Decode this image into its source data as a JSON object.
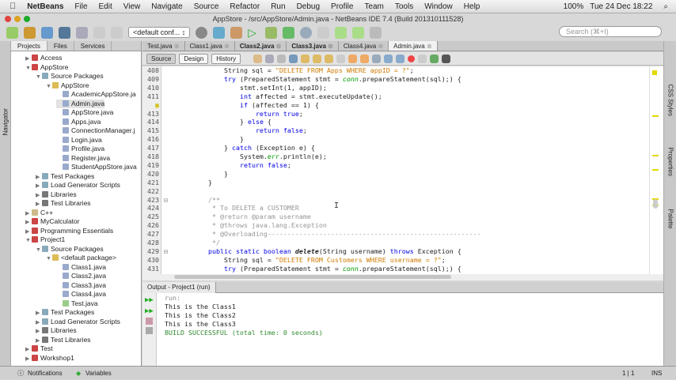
{
  "menubar": {
    "app": "NetBeans",
    "items": [
      "File",
      "Edit",
      "View",
      "Navigate",
      "Source",
      "Refactor",
      "Run",
      "Debug",
      "Profile",
      "Team",
      "Tools",
      "Window",
      "Help"
    ],
    "battery": "100%",
    "clock": "Tue 24 Dec  18:22"
  },
  "window": {
    "title": "AppStore - /src/AppStore/Admin.java - NetBeans IDE 7.4 (Build 201310111528)"
  },
  "toolbar": {
    "config": "<default conf... ↕",
    "search_placeholder": "Search (⌘+I)"
  },
  "navigator_label": "Navigator",
  "projects_panel": {
    "tabs": [
      "Projects",
      "Files",
      "Services"
    ],
    "tree": [
      {
        "label": "Access",
        "level": 0,
        "state": "collapsed",
        "icon": "project"
      },
      {
        "label": "AppStore",
        "level": 0,
        "state": "expanded",
        "icon": "project"
      },
      {
        "label": "Source Packages",
        "level": 1,
        "state": "expanded",
        "icon": "folder"
      },
      {
        "label": "AppStore",
        "level": 2,
        "state": "expanded",
        "icon": "package"
      },
      {
        "label": "AcademicAppStore.ja",
        "level": 3,
        "icon": "java-file"
      },
      {
        "label": "Admin.java",
        "level": 3,
        "icon": "java-file",
        "selected": true
      },
      {
        "label": "AppStore.java",
        "level": 3,
        "icon": "java-file"
      },
      {
        "label": "Apps.java",
        "level": 3,
        "icon": "java-file"
      },
      {
        "label": "ConnectionManager.j",
        "level": 3,
        "icon": "java-file"
      },
      {
        "label": "Login.java",
        "level": 3,
        "icon": "java-file"
      },
      {
        "label": "Profile.java",
        "level": 3,
        "icon": "java-file"
      },
      {
        "label": "Register.java",
        "level": 3,
        "icon": "java-file"
      },
      {
        "label": "StudentAppStore.java",
        "level": 3,
        "icon": "java-file"
      },
      {
        "label": "Test Packages",
        "level": 1,
        "state": "collapsed",
        "icon": "folder"
      },
      {
        "label": "Load Generator Scripts",
        "level": 1,
        "state": "collapsed",
        "icon": "folder"
      },
      {
        "label": "Libraries",
        "level": 1,
        "state": "collapsed",
        "icon": "library"
      },
      {
        "label": "Test Libraries",
        "level": 1,
        "state": "collapsed",
        "icon": "library"
      },
      {
        "label": "C++",
        "level": 0,
        "state": "collapsed",
        "icon": "cpp-project"
      },
      {
        "label": "MyCalculator",
        "level": 0,
        "state": "collapsed",
        "icon": "project"
      },
      {
        "label": "Programming Essentials",
        "level": 0,
        "state": "collapsed",
        "icon": "project"
      },
      {
        "label": "Project1",
        "level": 0,
        "state": "expanded",
        "icon": "project"
      },
      {
        "label": "Source Packages",
        "level": 1,
        "state": "expanded",
        "icon": "folder"
      },
      {
        "label": "<default package>",
        "level": 2,
        "state": "expanded",
        "icon": "package"
      },
      {
        "label": "Class1.java",
        "level": 3,
        "icon": "java-file"
      },
      {
        "label": "Class2.java",
        "level": 3,
        "icon": "java-file"
      },
      {
        "label": "Class3.java",
        "level": 3,
        "icon": "java-file"
      },
      {
        "label": "Class4.java",
        "level": 3,
        "icon": "java-file"
      },
      {
        "label": "Test.java",
        "level": 3,
        "icon": "java-main-file"
      },
      {
        "label": "Test Packages",
        "level": 1,
        "state": "collapsed",
        "icon": "folder"
      },
      {
        "label": "Load Generator Scripts",
        "level": 1,
        "state": "collapsed",
        "icon": "folder"
      },
      {
        "label": "Libraries",
        "level": 1,
        "state": "collapsed",
        "icon": "library"
      },
      {
        "label": "Test Libraries",
        "level": 1,
        "state": "collapsed",
        "icon": "library"
      },
      {
        "label": "Test",
        "level": 0,
        "state": "collapsed",
        "icon": "project"
      },
      {
        "label": "Workshop1",
        "level": 0,
        "state": "collapsed",
        "icon": "project"
      }
    ]
  },
  "editor": {
    "tabs": [
      {
        "label": "Test.java"
      },
      {
        "label": "Class1.java"
      },
      {
        "label": "Class2.java",
        "bold": true
      },
      {
        "label": "Class3.java",
        "bold": true
      },
      {
        "label": "Class4.java"
      },
      {
        "label": "Admin.java",
        "active": true
      }
    ],
    "views": [
      "Source",
      "Design",
      "History"
    ],
    "active_view": "Source",
    "lines": [
      {
        "n": "408",
        "indent": 8,
        "t": [
          [
            "String sql = ",
            ""
          ],
          [
            "\"DELETE FROM Apps WHERE appID = ?\"",
            "str"
          ],
          [
            ";",
            ""
          ]
        ]
      },
      {
        "n": "409",
        "indent": 8,
        "t": [
          [
            "try",
            "kw"
          ],
          [
            " (PreparedStatement stmt = ",
            ""
          ],
          [
            "conn",
            "fld"
          ],
          [
            ".prepareStatement(sql);) {",
            ""
          ]
        ]
      },
      {
        "n": "410",
        "indent": 12,
        "t": [
          [
            "stmt.setInt(1, appID);",
            ""
          ]
        ]
      },
      {
        "n": "411",
        "indent": 12,
        "t": [
          [
            "int",
            "kw"
          ],
          [
            " affected = stmt.executeUpdate();",
            ""
          ]
        ]
      },
      {
        "n": "",
        "indent": 12,
        "hint": true,
        "t": [
          [
            "if",
            "kw"
          ],
          [
            " (affected == 1) {",
            ""
          ]
        ]
      },
      {
        "n": "413",
        "indent": 16,
        "t": [
          [
            "return true",
            "kw"
          ],
          [
            ";",
            ""
          ]
        ]
      },
      {
        "n": "414",
        "indent": 12,
        "t": [
          [
            "} ",
            ""
          ],
          [
            "else",
            "kw"
          ],
          [
            " {",
            ""
          ]
        ]
      },
      {
        "n": "415",
        "indent": 16,
        "t": [
          [
            "return false",
            "kw"
          ],
          [
            ";",
            ""
          ]
        ]
      },
      {
        "n": "416",
        "indent": 12,
        "t": [
          [
            "}",
            ""
          ]
        ]
      },
      {
        "n": "417",
        "indent": 8,
        "t": [
          [
            "} ",
            ""
          ],
          [
            "catch",
            "kw"
          ],
          [
            " (Exception e) {",
            ""
          ]
        ]
      },
      {
        "n": "418",
        "indent": 12,
        "t": [
          [
            "System.",
            ""
          ],
          [
            "err",
            "fld"
          ],
          [
            ".println(e);",
            ""
          ]
        ]
      },
      {
        "n": "419",
        "indent": 12,
        "t": [
          [
            "return false",
            "kw"
          ],
          [
            ";",
            ""
          ]
        ]
      },
      {
        "n": "420",
        "indent": 8,
        "t": [
          [
            "}",
            ""
          ]
        ]
      },
      {
        "n": "421",
        "indent": 4,
        "t": [
          [
            "}",
            ""
          ]
        ]
      },
      {
        "n": "422",
        "indent": 0,
        "t": []
      },
      {
        "n": "423",
        "indent": 4,
        "fold": true,
        "t": [
          [
            "/**",
            "cm"
          ]
        ]
      },
      {
        "n": "424",
        "indent": 4,
        "t": [
          [
            " * To DELETE a CUSTOMER",
            "cm"
          ]
        ]
      },
      {
        "n": "425",
        "indent": 4,
        "t": [
          [
            " * @return @param username",
            "cm"
          ]
        ]
      },
      {
        "n": "426",
        "indent": 4,
        "t": [
          [
            " * @throws java.lang.Exception",
            "cm"
          ]
        ]
      },
      {
        "n": "427",
        "indent": 4,
        "t": [
          [
            " * @Overloading------------------------------------------------------",
            "cm"
          ]
        ]
      },
      {
        "n": "428",
        "indent": 4,
        "t": [
          [
            " */",
            "cm"
          ]
        ]
      },
      {
        "n": "429",
        "indent": 4,
        "fold": true,
        "t": [
          [
            "public static boolean ",
            "kw"
          ],
          [
            "delete",
            "it"
          ],
          [
            "(String username) ",
            ""
          ],
          [
            "throws",
            "kw"
          ],
          [
            " Exception {",
            ""
          ]
        ]
      },
      {
        "n": "430",
        "indent": 8,
        "t": [
          [
            "String sql = ",
            ""
          ],
          [
            "\"DELETE FROM Customers WHERE username = ?\"",
            "str"
          ],
          [
            ";",
            ""
          ]
        ]
      },
      {
        "n": "431",
        "indent": 8,
        "t": [
          [
            "try",
            "kw"
          ],
          [
            " (PreparedStatement stmt = ",
            ""
          ],
          [
            "conn",
            "fld"
          ],
          [
            ".prepareStatement(sql);) {",
            ""
          ]
        ]
      }
    ]
  },
  "right_panels": [
    "CSS Styles",
    "Properties",
    "Palette"
  ],
  "output": {
    "title": "Output - Project1 (run)",
    "lines": [
      {
        "text": "run:",
        "kind": "info"
      },
      {
        "text": "This is the Class1",
        "kind": "out"
      },
      {
        "text": "This is the Class2",
        "kind": "out"
      },
      {
        "text": "This is the Class3",
        "kind": "out"
      },
      {
        "text": "BUILD SUCCESSFUL (total time: 0 seconds)",
        "kind": "success"
      }
    ]
  },
  "statusbar": {
    "notifications": "Notifications",
    "variables": "Variables",
    "position": "1 | 1",
    "mode": "INS"
  },
  "colors": {
    "keyword": "#0000e6",
    "string": "#ce7b00",
    "comment": "#969696",
    "success": "#2e8b2e"
  }
}
